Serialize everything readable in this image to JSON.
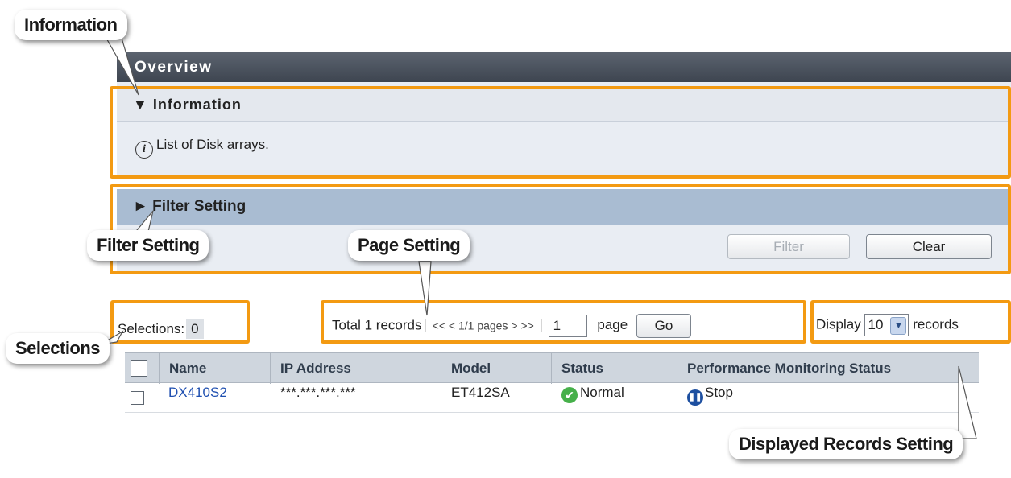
{
  "overview": {
    "title": "Overview"
  },
  "information": {
    "header": "▼ Information",
    "message": "List of Disk arrays."
  },
  "filter": {
    "header": "► Filter Setting",
    "filter_label": "Filter",
    "clear_label": "Clear"
  },
  "selections": {
    "label": "Selections:",
    "count": "0"
  },
  "pager": {
    "total": "Total 1 records",
    "nav": "<< < 1/1 pages > >>",
    "page_value": "1",
    "page_label": "page",
    "go_label": "Go"
  },
  "display": {
    "label": "Display",
    "value": "10",
    "suffix": "records"
  },
  "table": {
    "columns": [
      "Name",
      "IP Address",
      "Model",
      "Status",
      "Performance Monitoring Status"
    ],
    "rows": [
      {
        "name": "DX410S2",
        "ip": "***.***.***.***",
        "model": "ET412SA",
        "status": "Normal",
        "perf": "Stop"
      }
    ]
  },
  "callouts": {
    "information": "Information",
    "filter_setting": "Filter Setting",
    "page_setting": "Page Setting",
    "selections": "Selections",
    "displayed_records": "Displayed Records Setting"
  },
  "colors": {
    "highlight": "#f39a12",
    "header_dark": "#4a515c",
    "filter_header": "#a9bcd2"
  },
  "icons": {
    "info": "info-icon",
    "normal_status": "check-circle-icon",
    "stop_status": "pause-circle-icon",
    "dropdown": "chevron-down-icon"
  }
}
